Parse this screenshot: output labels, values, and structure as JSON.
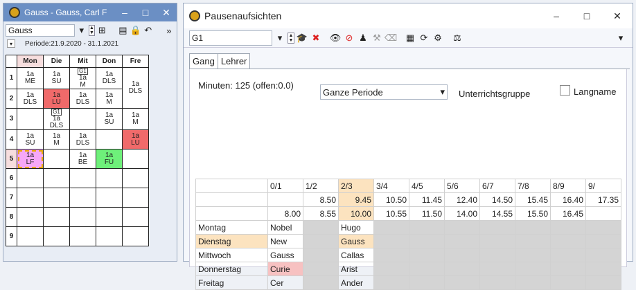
{
  "w1": {
    "title": "Gauss - Gauss, Carl F",
    "teacher": "Gauss",
    "period": "Periode:21.9.2020 - 31.1.2021",
    "days": [
      "Mon",
      "Die",
      "Mit",
      "Don",
      "Fre"
    ],
    "hours": [
      "1",
      "2",
      "3",
      "4",
      "5",
      "6",
      "7",
      "8",
      "9"
    ],
    "grid": [
      [
        {
          "t": "1a\nME"
        },
        {
          "t": "1a\nSU"
        },
        {
          "t": "1a\nM",
          "tag": "G1"
        },
        {
          "t": "1a\nDLS"
        },
        {
          "t": "1a\nDLS",
          "rs": 2
        }
      ],
      [
        {
          "t": "1a\nDLS"
        },
        {
          "t": "1a\nLU",
          "c": "lu"
        },
        {
          "t": "1a\nDLS"
        },
        {
          "t": "1a\nM"
        },
        null
      ],
      [
        {
          "t": ""
        },
        {
          "t": "1a\nDLS",
          "tag": "G1"
        },
        {
          "t": ""
        },
        {
          "t": "1a\nSU"
        },
        {
          "t": "1a\nM"
        }
      ],
      [
        {
          "t": "1a\nSU"
        },
        {
          "t": "1a\nM"
        },
        {
          "t": "1a\nDLS"
        },
        {
          "t": ""
        },
        {
          "t": "1a\nLU",
          "c": "lu"
        }
      ],
      [
        {
          "t": "1a\nLF",
          "c": "lf"
        },
        {
          "t": ""
        },
        {
          "t": "1a\nBE"
        },
        {
          "t": "1a\nFU",
          "c": "fu"
        },
        {
          "t": ""
        }
      ],
      [
        {
          "t": ""
        },
        {
          "t": ""
        },
        {
          "t": ""
        },
        {
          "t": ""
        },
        {
          "t": ""
        }
      ],
      [
        {
          "t": ""
        },
        {
          "t": ""
        },
        {
          "t": ""
        },
        {
          "t": ""
        },
        {
          "t": ""
        }
      ],
      [
        {
          "t": ""
        },
        {
          "t": ""
        },
        {
          "t": ""
        },
        {
          "t": ""
        },
        {
          "t": ""
        }
      ],
      [
        {
          "t": ""
        },
        {
          "t": ""
        },
        {
          "t": ""
        },
        {
          "t": ""
        },
        {
          "t": ""
        }
      ]
    ]
  },
  "w2": {
    "title": "Pausenaufsichten",
    "selector": "G1",
    "tabs": [
      "Gang",
      "Lehrer"
    ],
    "minutes": "Minuten: 125 (offen:0.0)",
    "period_select": "Ganze Periode",
    "group_label": "Unterrichtsgruppe",
    "longname_label": "Langname",
    "cols": [
      "0/1",
      "1/2",
      "2/3",
      "3/4",
      "4/5",
      "5/6",
      "6/7",
      "7/8",
      "8/9",
      "9/"
    ],
    "start": [
      "",
      "8.50",
      "9.45",
      "10.50",
      "11.45",
      "12.40",
      "14.50",
      "15.45",
      "16.40",
      "17.35"
    ],
    "end": [
      "8.00",
      "8.55",
      "10.00",
      "10.55",
      "11.50",
      "14.00",
      "14.55",
      "15.50",
      "16.45",
      ""
    ],
    "rows": [
      {
        "day": "Montag",
        "c0": "Nobel",
        "c2": "Hugo"
      },
      {
        "day": "Dienstag",
        "c0": "New",
        "c2": "Gauss",
        "hl": true
      },
      {
        "day": "Mittwoch",
        "c0": "Gauss",
        "c2": "Callas"
      },
      {
        "day": "Donnerstag",
        "c0": "Curie",
        "c2": "Arist",
        "pink": true
      },
      {
        "day": "Freitag",
        "c0": "Cer",
        "c2": "Ander"
      }
    ]
  }
}
